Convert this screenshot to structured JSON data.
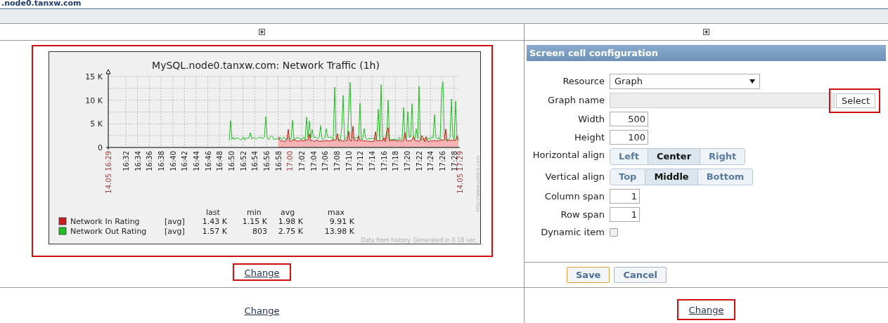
{
  "page_title": ".node0.tanxw.com",
  "graph": {
    "title": "MySQL.node0.tanxw.com: Network Traffic (1h)",
    "yticks": [
      "15 K",
      "10 K",
      "5 K",
      "0"
    ],
    "xlabels": [
      {
        "label": "14.05 16:29",
        "kind": "edge"
      },
      {
        "label": "16:32",
        "kind": "minor"
      },
      {
        "label": "16:34",
        "kind": "minor"
      },
      {
        "label": "16:36",
        "kind": "minor"
      },
      {
        "label": "16:38",
        "kind": "minor"
      },
      {
        "label": "16:40",
        "kind": "minor"
      },
      {
        "label": "16:42",
        "kind": "minor"
      },
      {
        "label": "16:44",
        "kind": "minor"
      },
      {
        "label": "16:46",
        "kind": "minor"
      },
      {
        "label": "16:48",
        "kind": "minor"
      },
      {
        "label": "16:50",
        "kind": "minor"
      },
      {
        "label": "16:52",
        "kind": "minor"
      },
      {
        "label": "16:54",
        "kind": "minor"
      },
      {
        "label": "16:56",
        "kind": "minor"
      },
      {
        "label": "16:58",
        "kind": "minor"
      },
      {
        "label": "17:00",
        "kind": "hour"
      },
      {
        "label": "17:02",
        "kind": "minor"
      },
      {
        "label": "17:04",
        "kind": "minor"
      },
      {
        "label": "17:06",
        "kind": "minor"
      },
      {
        "label": "17:08",
        "kind": "minor"
      },
      {
        "label": "17:10",
        "kind": "minor"
      },
      {
        "label": "17:12",
        "kind": "minor"
      },
      {
        "label": "17:14",
        "kind": "minor"
      },
      {
        "label": "17:16",
        "kind": "minor"
      },
      {
        "label": "17:18",
        "kind": "minor"
      },
      {
        "label": "17:20",
        "kind": "minor"
      },
      {
        "label": "17:22",
        "kind": "minor"
      },
      {
        "label": "17:24",
        "kind": "minor"
      },
      {
        "label": "17:26",
        "kind": "minor"
      },
      {
        "label": "17:28",
        "kind": "minor"
      },
      {
        "label": "14.05 17:29",
        "kind": "edge"
      }
    ],
    "legend_headers": [
      "last",
      "min",
      "avg",
      "max"
    ],
    "legend": [
      {
        "name": "Network In Rating",
        "color": "#c81e1e",
        "func": "[avg]",
        "values": [
          "1.43 K",
          "1.15 K",
          "1.98 K",
          "9.91 K"
        ]
      },
      {
        "name": "Network Out Rating",
        "color": "#22c022",
        "func": "[avg]",
        "values": [
          "1.57 K",
          "803",
          "2.75 K",
          "13.98 K"
        ]
      }
    ],
    "side_text": "http://www.zabbix.com",
    "footer": "Data from history. Generated in 0.18 sec."
  },
  "left_change": "Change",
  "config": {
    "title": "Screen cell configuration",
    "resource": {
      "label": "Resource",
      "value": "Graph"
    },
    "graph_name": {
      "label": "Graph name",
      "button": "Select"
    },
    "width": {
      "label": "Width",
      "value": "500"
    },
    "height": {
      "label": "Height",
      "value": "100"
    },
    "halign": {
      "label": "Horizontal align",
      "options": [
        {
          "label": "Left",
          "selected": false
        },
        {
          "label": "Center",
          "selected": true
        },
        {
          "label": "Right",
          "selected": false
        }
      ]
    },
    "valign": {
      "label": "Vertical align",
      "options": [
        {
          "label": "Top",
          "selected": false
        },
        {
          "label": "Middle",
          "selected": true
        },
        {
          "label": "Bottom",
          "selected": false
        }
      ]
    },
    "colspan": {
      "label": "Column span",
      "value": "1"
    },
    "rowspan": {
      "label": "Row span",
      "value": "1"
    },
    "dynamic": {
      "label": "Dynamic item",
      "checked": false
    },
    "buttons": [
      "Save",
      "Cancel"
    ]
  },
  "bottom_links": [
    "Change",
    "Change"
  ]
}
